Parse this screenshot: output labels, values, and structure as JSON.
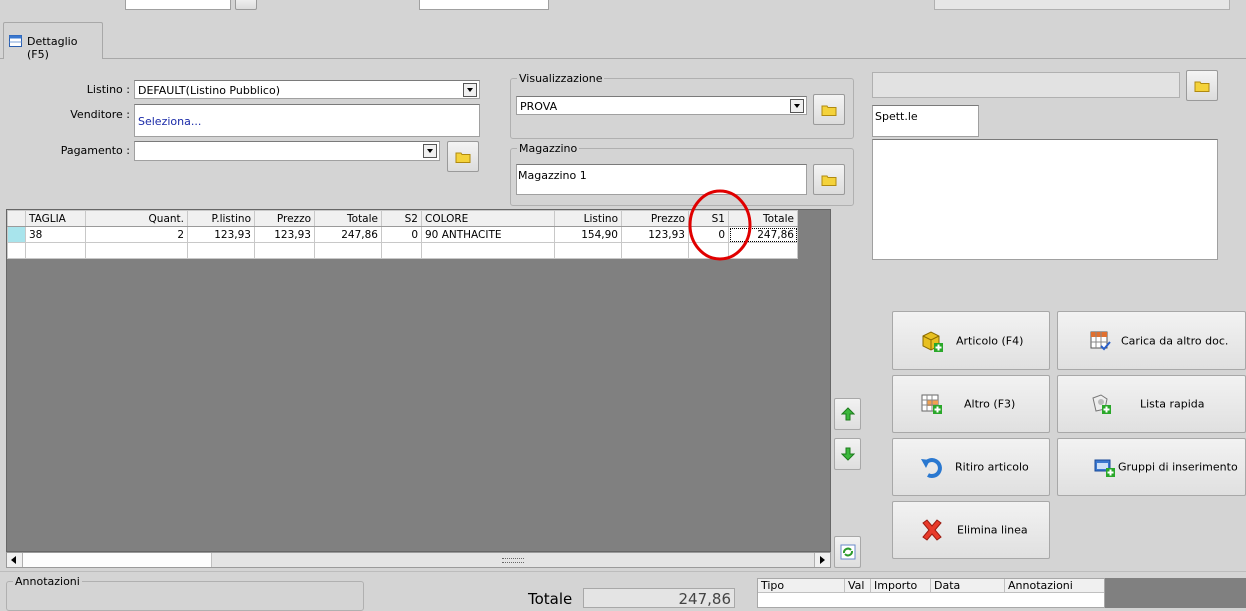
{
  "tab": {
    "label": "Dettaglio (F5)"
  },
  "form": {
    "listino_label": "Listino :",
    "listino_value": "DEFAULT(Listino Pubblico)",
    "venditore_label": "Venditore :",
    "venditore_value": "Seleziona...",
    "pagamento_label": "Pagamento :",
    "pagamento_value": ""
  },
  "visualizzazione": {
    "title": "Visualizzazione",
    "value": "PROVA"
  },
  "magazzino": {
    "title": "Magazzino",
    "value": "Magazzino 1"
  },
  "cliente": {
    "spett_label": "Spett.le"
  },
  "grid": {
    "headers": [
      "TAGLIA",
      "Quant.",
      "P.listino",
      "Prezzo",
      "Totale",
      "S2",
      "COLORE",
      "Listino",
      "Prezzo",
      "S1",
      "Totale"
    ],
    "rows": [
      [
        "38",
        "2",
        "123,93",
        "123,93",
        "247,86",
        "0",
        "90 ANTHACITE",
        "154,90",
        "123,93",
        "0",
        "247,86"
      ]
    ]
  },
  "actions": {
    "articolo": "Articolo (F4)",
    "carica": "Carica da altro doc.",
    "altro": "Altro (F3)",
    "lista": "Lista rapida",
    "ritiro": "Ritiro articolo",
    "gruppi": "Gruppi di inserimento",
    "elimina": "Elimina linea"
  },
  "annotazioni": {
    "title": "Annotazioni"
  },
  "totale": {
    "label": "Totale",
    "value": "247,86"
  },
  "payments": {
    "headers": [
      "Tipo",
      "Val",
      "Importo",
      "Data",
      "Annotazioni"
    ]
  },
  "colors": {
    "grid_bg": "#808080",
    "highlight": "#e00000"
  }
}
